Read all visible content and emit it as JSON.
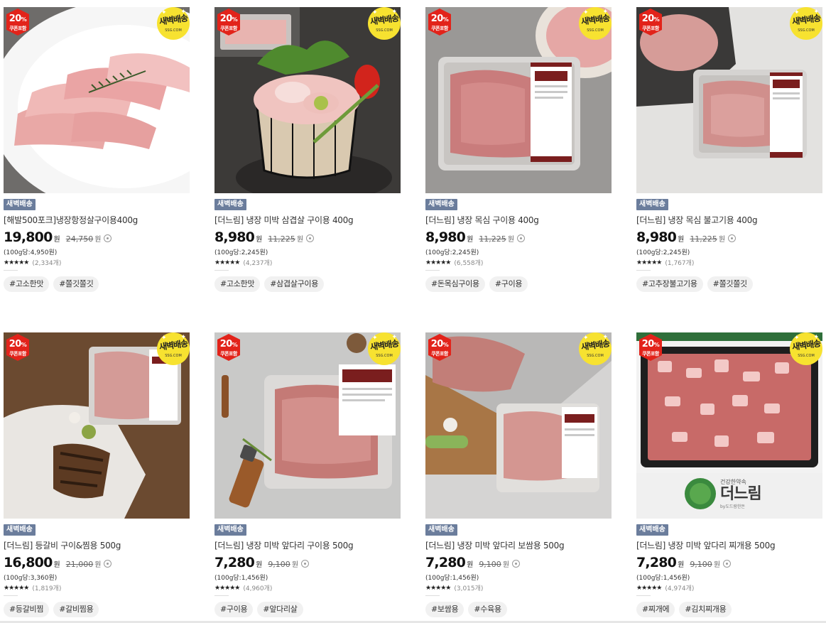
{
  "products": [
    {
      "coupon_pct": "20",
      "coupon_pct_unit": "%",
      "coupon_label": "쿠폰포함",
      "badge_line1": "새벽배송",
      "badge_line2": "SSG.COM",
      "delivery_tag": "새벽배송",
      "title": "[해발500포크]냉장항정살구이용400g",
      "price": "19,800",
      "price_unit": "원",
      "original_price": "24,750",
      "original_unit": "원",
      "unit_price": "(100g당:4,950원)",
      "stars": "★★★★★",
      "reviews": "(2,334개)",
      "hashtags": [
        "#고소한맛",
        "#쫄깃쫄깃"
      ],
      "image": "pork-jowl-plate"
    },
    {
      "coupon_pct": "20",
      "coupon_pct_unit": "%",
      "coupon_label": "쿠폰포함",
      "badge_line1": "새벽배송",
      "badge_line2": "SSG.COM",
      "delivery_tag": "새벽배송",
      "title": "[더느림] 냉장 미박 삼겹살 구이용 400g",
      "price": "8,980",
      "price_unit": "원",
      "original_price": "11,225",
      "original_unit": "원",
      "unit_price": "(100g당:2,245원)",
      "stars": "★★★★★",
      "reviews": "(4,237개)",
      "hashtags": [
        "#고소한맛",
        "#삼겹살구이용"
      ],
      "image": "pork-belly-basket"
    },
    {
      "coupon_pct": "20",
      "coupon_pct_unit": "%",
      "coupon_label": "쿠폰포함",
      "badge_line1": "새벽배송",
      "badge_line2": "SSG.COM",
      "delivery_tag": "새벽배송",
      "title": "[더느림] 냉장 목심 구이용 400g",
      "price": "8,980",
      "price_unit": "원",
      "original_price": "11,225",
      "original_unit": "원",
      "unit_price": "(100g당:2,245원)",
      "stars": "★★★★★",
      "reviews": "(6,558개)",
      "hashtags": [
        "#돈목심구이용",
        "#구이용"
      ],
      "image": "pork-neck-tray"
    },
    {
      "coupon_pct": "20",
      "coupon_pct_unit": "%",
      "coupon_label": "쿠폰포함",
      "badge_line1": "새벽배송",
      "badge_line2": "SSG.COM",
      "delivery_tag": "새벽배송",
      "title": "[더느림] 냉장 목심 불고기용 400g",
      "price": "8,980",
      "price_unit": "원",
      "original_price": "11,225",
      "original_unit": "원",
      "unit_price": "(100g당:2,245원)",
      "stars": "★★★★★",
      "reviews": "(1,767개)",
      "hashtags": [
        "#고추장불고기용",
        "#쫄깃쫄깃"
      ],
      "image": "pork-neck-bulgogi-tray"
    },
    {
      "coupon_pct": "20",
      "coupon_pct_unit": "%",
      "coupon_label": "쿠폰포함",
      "badge_line1": "새벽배송",
      "badge_line2": "SSG.COM",
      "delivery_tag": "새벽배송",
      "title": "[더느림] 등갈비 구이&찜용 500g",
      "price": "16,800",
      "price_unit": "원",
      "original_price": "21,000",
      "original_unit": "원",
      "unit_price": "(100g당:3,360원)",
      "stars": "★★★★★",
      "reviews": "(1,819개)",
      "hashtags": [
        "#등갈비찜",
        "#갈비찜용"
      ],
      "image": "pork-ribs-board"
    },
    {
      "coupon_pct": "20",
      "coupon_pct_unit": "%",
      "coupon_label": "쿠폰포함",
      "badge_line1": "새벽배송",
      "badge_line2": "SSG.COM",
      "delivery_tag": "새벽배송",
      "title": "[더느림] 냉장 미박 앞다리 구이용 500g",
      "price": "7,280",
      "price_unit": "원",
      "original_price": "9,100",
      "original_unit": "원",
      "unit_price": "(100g당:1,456원)",
      "stars": "★★★★★",
      "reviews": "(4,960개)",
      "hashtags": [
        "#구이용",
        "#앞다리살"
      ],
      "image": "pork-shoulder-tray"
    },
    {
      "coupon_pct": "20",
      "coupon_pct_unit": "%",
      "coupon_label": "쿠폰포함",
      "badge_line1": "새벽배송",
      "badge_line2": "SSG.COM",
      "delivery_tag": "새벽배송",
      "title": "[더느림] 냉장 미박 앞다리 보쌈용 500g",
      "price": "7,280",
      "price_unit": "원",
      "original_price": "9,100",
      "original_unit": "원",
      "unit_price": "(100g당:1,456원)",
      "stars": "★★★★★",
      "reviews": "(3,015개)",
      "hashtags": [
        "#보쌈용",
        "#수육용"
      ],
      "image": "pork-shoulder-bossam"
    },
    {
      "coupon_pct": "20",
      "coupon_pct_unit": "%",
      "coupon_label": "쿠폰포함",
      "badge_line1": "새벽배송",
      "badge_line2": "SSG.COM",
      "delivery_tag": "새벽배송",
      "title": "[더느림] 냉장 미박 앞다리 찌개용 500g",
      "price": "7,280",
      "price_unit": "원",
      "original_price": "9,100",
      "original_unit": "원",
      "unit_price": "(100g당:1,456원)",
      "stars": "★★★★★",
      "reviews": "(4,974개)",
      "hashtags": [
        "#찌개에",
        "#김치찌개용"
      ],
      "image": "pork-stew-cubes",
      "brand_small": "건강한약속",
      "brand_name": "더느림",
      "brand_sub": "by도드람한돈"
    }
  ],
  "colors": {
    "coupon_red": "#e2231a",
    "dawn_yellow": "#f7e230",
    "tag_blue": "#6b7d9c",
    "hashtag_bg": "#f1f1f1"
  }
}
